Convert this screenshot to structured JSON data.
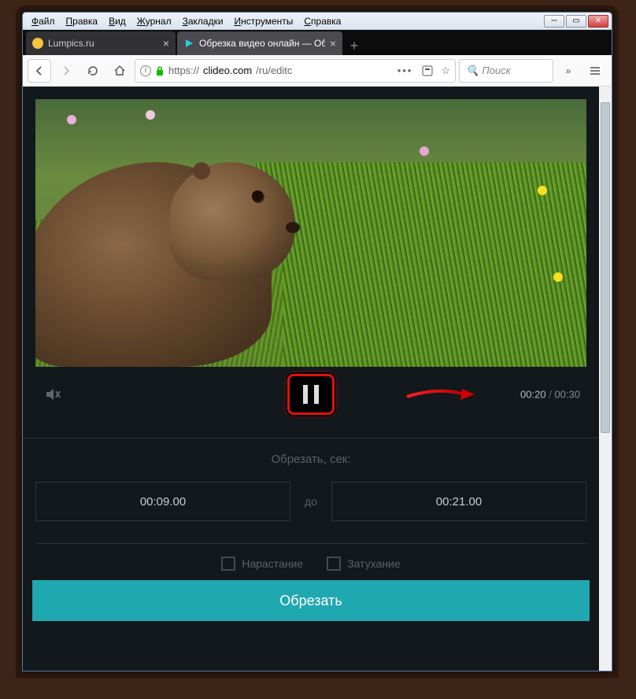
{
  "menubar": {
    "file": "Файл",
    "edit": "Правка",
    "view": "Вид",
    "history": "Журнал",
    "bookmarks": "Закладки",
    "tools": "Инструменты",
    "help": "Справка"
  },
  "tabs": [
    {
      "title": "Lumpics.ru",
      "active": false
    },
    {
      "title": "Обрезка видео онлайн — Обр",
      "active": true
    }
  ],
  "url": {
    "scheme": "https://",
    "domain": "clideo.com",
    "path": "/ru/editc"
  },
  "search": {
    "placeholder": "Поиск"
  },
  "player": {
    "current_time": "00:20",
    "total_time": "00:30"
  },
  "trim": {
    "section_label": "Обрезать, сек:",
    "start": "00:09.00",
    "to_label": "до",
    "end": "00:21.00"
  },
  "fade": {
    "in_label": "Нарастание",
    "out_label": "Затухание"
  },
  "buttons": {
    "cut": "Обрезать"
  },
  "colors": {
    "accent": "#1fa8b0",
    "highlight": "#e01010",
    "bg": "#13181c"
  }
}
